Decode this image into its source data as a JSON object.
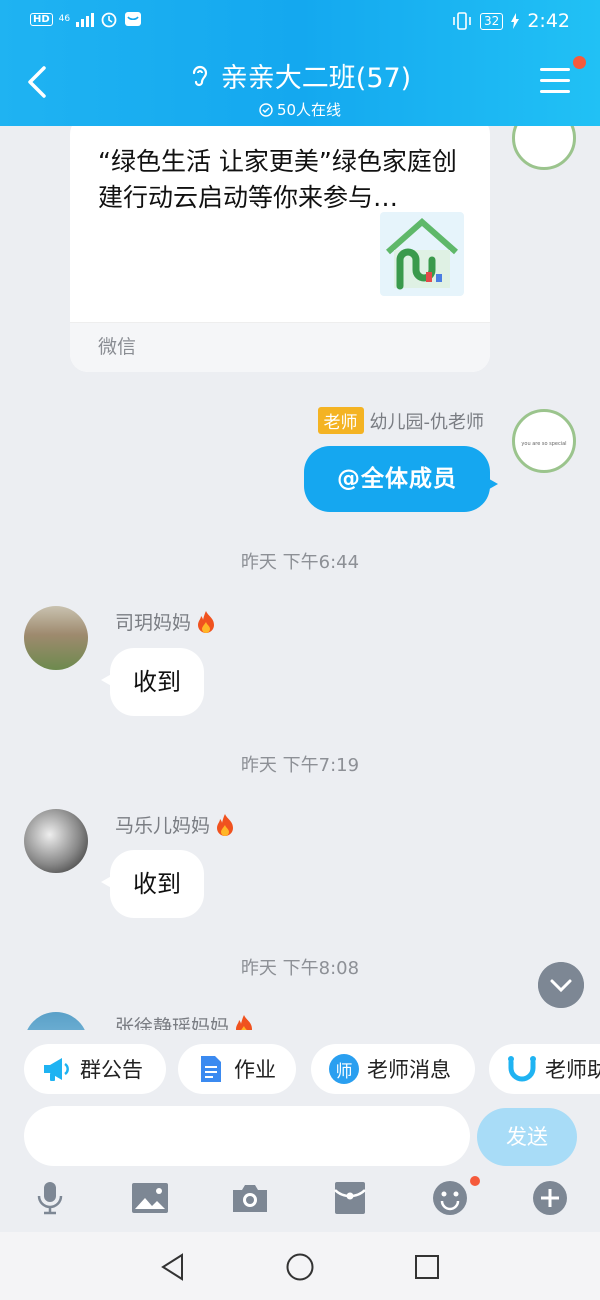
{
  "status_bar": {
    "hd": "HD",
    "network": "46",
    "battery": "32",
    "time": "2:42"
  },
  "header": {
    "title": "亲亲大二班(57)",
    "online": "50人在线"
  },
  "shared_card": {
    "title": "“绿色生活 让家更美”绿色家庭创建行动云启动等你来参与…",
    "source": "微信"
  },
  "teacher_message": {
    "tag": "老师",
    "sender": "幼儿园-仇老师",
    "text": "@全体成员",
    "avatar_caption": "you are so special"
  },
  "messages": [
    {
      "time": "昨天 下午6:44",
      "sender": "司玥妈妈",
      "text": "收到"
    },
    {
      "time": "昨天 下午7:19",
      "sender": "马乐儿妈妈",
      "text": "收到"
    },
    {
      "time": "昨天 下午8:08",
      "sender": "张徐静瑶妈妈",
      "text": ""
    }
  ],
  "quick_actions": [
    {
      "label": "群公告",
      "icon": "megaphone-icon"
    },
    {
      "label": "作业",
      "icon": "document-icon"
    },
    {
      "label": "老师消息",
      "icon": "teacher-badge-icon",
      "icon_text": "师"
    },
    {
      "label": "老师助",
      "icon": "smile-logo-icon"
    }
  ],
  "input": {
    "placeholder": "",
    "send_label": "发送"
  },
  "toolbar": [
    "microphone-icon",
    "image-icon",
    "camera-icon",
    "red-packet-icon",
    "emoji-icon",
    "plus-icon"
  ],
  "colors": {
    "header": "#14a8ef",
    "bubble_self": "#15a7f0",
    "teacher_tag": "#f4b323",
    "badge_dot": "#f55a3c"
  }
}
